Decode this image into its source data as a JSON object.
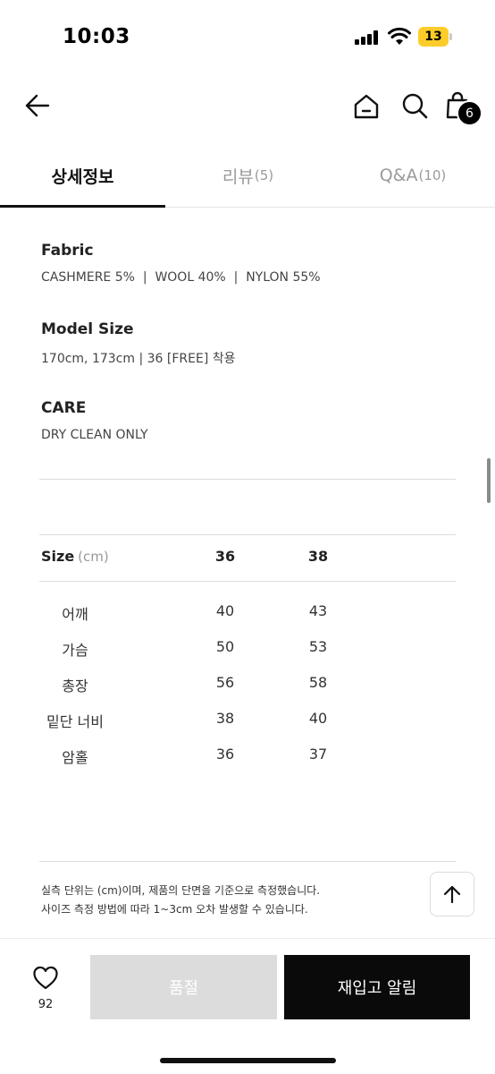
{
  "status_bar": {
    "time": "10:03",
    "battery": "13"
  },
  "header": {
    "icons": [
      "back-arrow-icon",
      "home-icon",
      "search-icon",
      "shopping-bag-icon"
    ],
    "cart_count": "6"
  },
  "tabs": [
    {
      "label": "상세정보",
      "count": ""
    },
    {
      "label": "리뷰",
      "count": "(5)"
    },
    {
      "label": "Q&A",
      "count": "(10)"
    }
  ],
  "details": {
    "fabric": {
      "title": "Fabric",
      "value": "CASHMERE 5%  |  WOOL 40%  |  NYLON 55%"
    },
    "model_size": {
      "title": "Model Size",
      "value": "170cm, 173cm | 36 [FREE] 착용"
    },
    "care": {
      "title": "CARE",
      "value": "DRY CLEAN ONLY"
    }
  },
  "size_table": {
    "label": "Size",
    "unit": "(cm)",
    "columns": [
      "36",
      "38"
    ],
    "rows": [
      {
        "name": "어깨",
        "values": [
          "40",
          "43"
        ]
      },
      {
        "name": "가슴",
        "values": [
          "50",
          "53"
        ]
      },
      {
        "name": "총장",
        "values": [
          "56",
          "58"
        ]
      },
      {
        "name": "밑단 너비",
        "values": [
          "38",
          "40"
        ]
      },
      {
        "name": "암홀",
        "values": [
          "36",
          "37"
        ]
      }
    ]
  },
  "notes": [
    "실측 단위는 (cm)이며, 제품의 단면을 기준으로 측정했습니다.",
    "사이즈 측정 방법에 따라 1~3cm 오차 발생할 수 있습니다."
  ],
  "bottom_bar": {
    "wish_count": "92",
    "soldout_label": "품절",
    "restock_label": "재입고 알림"
  },
  "colors": {
    "accent": "#0a0a0a",
    "disabled": "#dcdcdc",
    "badge": "#000000",
    "battery": "#fccd2a"
  }
}
